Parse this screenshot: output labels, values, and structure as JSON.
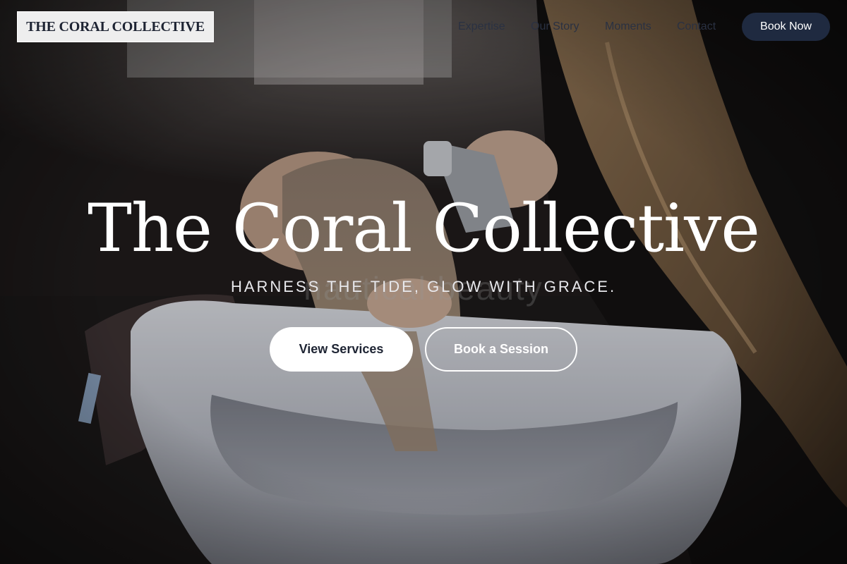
{
  "brand": {
    "logo_text": "THE CORAL COLLECTIVE"
  },
  "nav": {
    "items": [
      {
        "label": "Expertise"
      },
      {
        "label": "Our Story"
      },
      {
        "label": "Moments"
      },
      {
        "label": "Contact"
      }
    ],
    "cta_label": "Book Now"
  },
  "hero": {
    "title": "The Coral Collective",
    "tagline": "HARNESS THE TIDE, GLOW WITH GRACE.",
    "watermark": "nautical.beauty",
    "primary_button": "View Services",
    "secondary_button": "Book a Session",
    "image_description": "stylist-washing-client-hair-at-salon-basin"
  },
  "colors": {
    "brand_navy": "#1f2a40",
    "logo_bg": "#eeeeee",
    "text_light": "#ffffff"
  }
}
